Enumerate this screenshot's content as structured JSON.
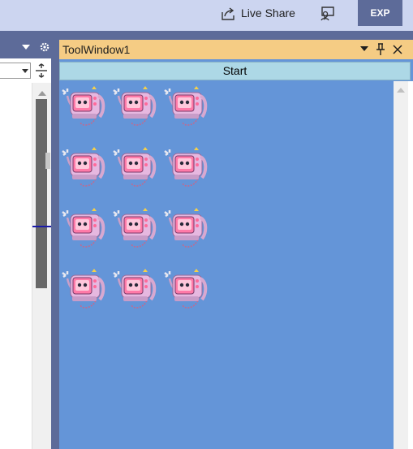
{
  "titlebar": {
    "live_share_label": "Live Share",
    "share_icon": "share-icon",
    "feedback_icon": "feedback-icon",
    "badge": "EXP",
    "background": "#ccd5f0",
    "badge_color": "#5d6b99"
  },
  "left_panel": {
    "icons": [
      "chevron-down-icon",
      "gear-icon",
      "split-view-icon",
      "scroll-up-icon"
    ]
  },
  "tool_window": {
    "title": "ToolWindow1",
    "header_color": "#f5cc84",
    "body_color": "#6495d8",
    "start_label": "Start",
    "start_color": "#add8e6",
    "icons": [
      "chevron-down-icon",
      "pin-icon",
      "close-icon"
    ],
    "sprites": {
      "rows": 4,
      "columns": 3,
      "icon": "pink-robot-sprite-icon"
    }
  }
}
